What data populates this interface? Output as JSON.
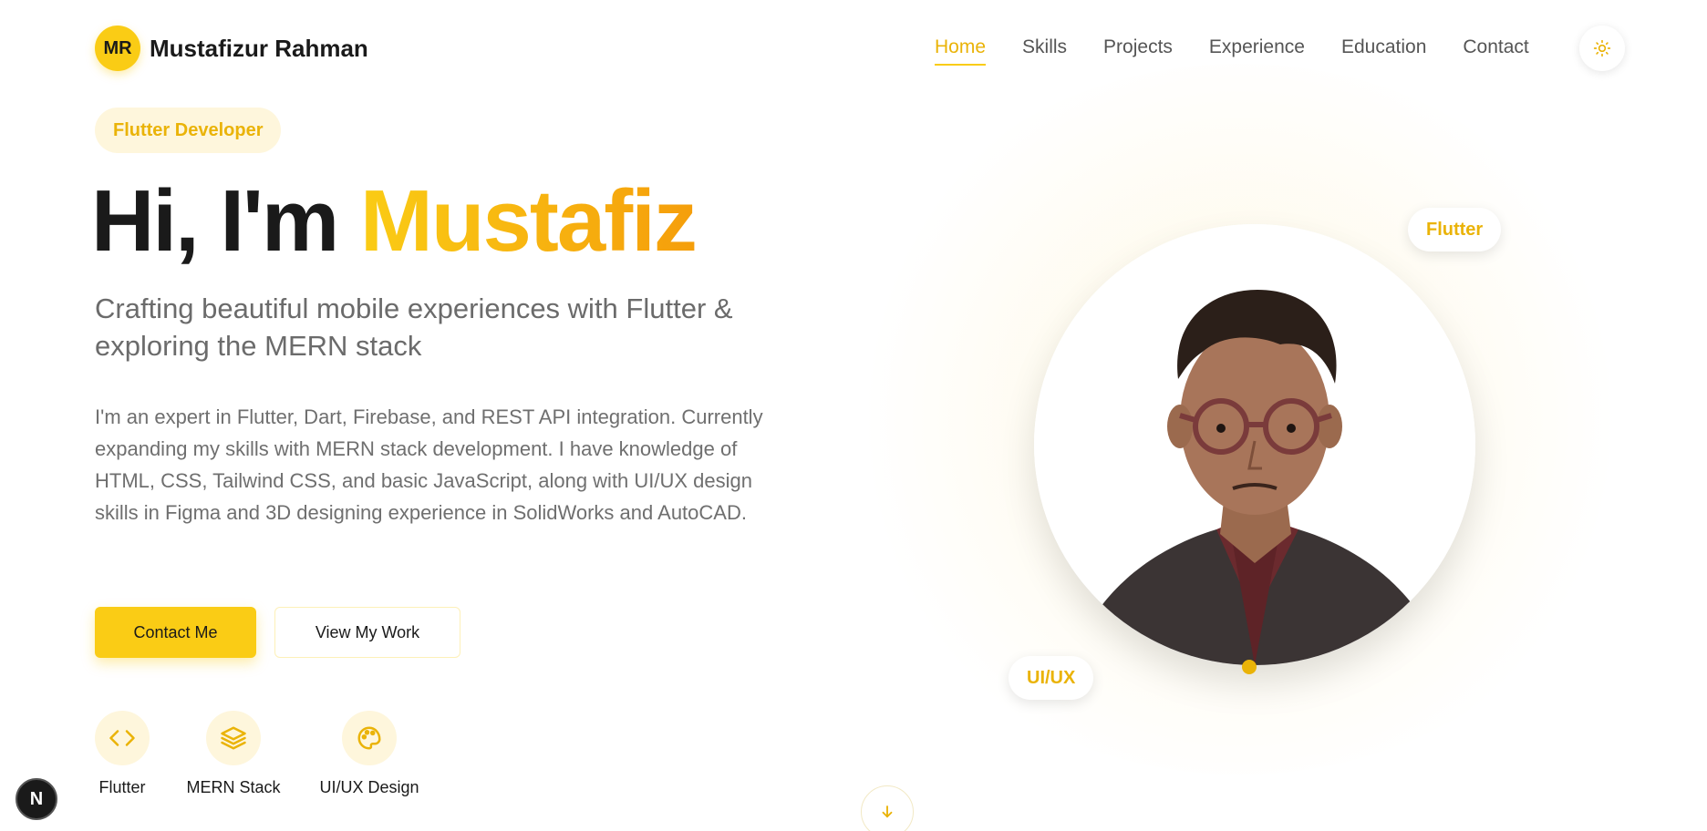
{
  "header": {
    "logo_initials": "MR",
    "brand_name": "Mustafizur Rahman",
    "nav": [
      {
        "label": "Home",
        "active": true
      },
      {
        "label": "Skills"
      },
      {
        "label": "Projects"
      },
      {
        "label": "Experience"
      },
      {
        "label": "Education"
      },
      {
        "label": "Contact"
      }
    ],
    "theme_toggle_icon": "sun-icon"
  },
  "hero": {
    "badge": "Flutter Developer",
    "title_prefix": "Hi, I'm ",
    "title_name": "Mustafiz",
    "subtitle": "Crafting beautiful mobile experiences with Flutter & exploring the MERN stack",
    "description": "I'm an expert in Flutter, Dart, Firebase, and REST API integration. Currently expanding my skills with MERN stack development. I have knowledge of HTML, CSS, Tailwind CSS, and basic JavaScript, along with UI/UX design skills in Figma and 3D designing experience in SolidWorks and AutoCAD.",
    "primary_button": "Contact Me",
    "secondary_button": "View My Work",
    "skills": [
      {
        "label": "Flutter",
        "icon": "code-icon"
      },
      {
        "label": "MERN Stack",
        "icon": "layers-icon"
      },
      {
        "label": "UI/UX Design",
        "icon": "palette-icon"
      }
    ]
  },
  "visual": {
    "tag_flutter": "Flutter",
    "tag_uiux": "UI/UX"
  },
  "next_badge": "N",
  "colors": {
    "accent": "#facc15",
    "accent_dark": "#eab308",
    "accent_soft": "#fef6dc"
  }
}
